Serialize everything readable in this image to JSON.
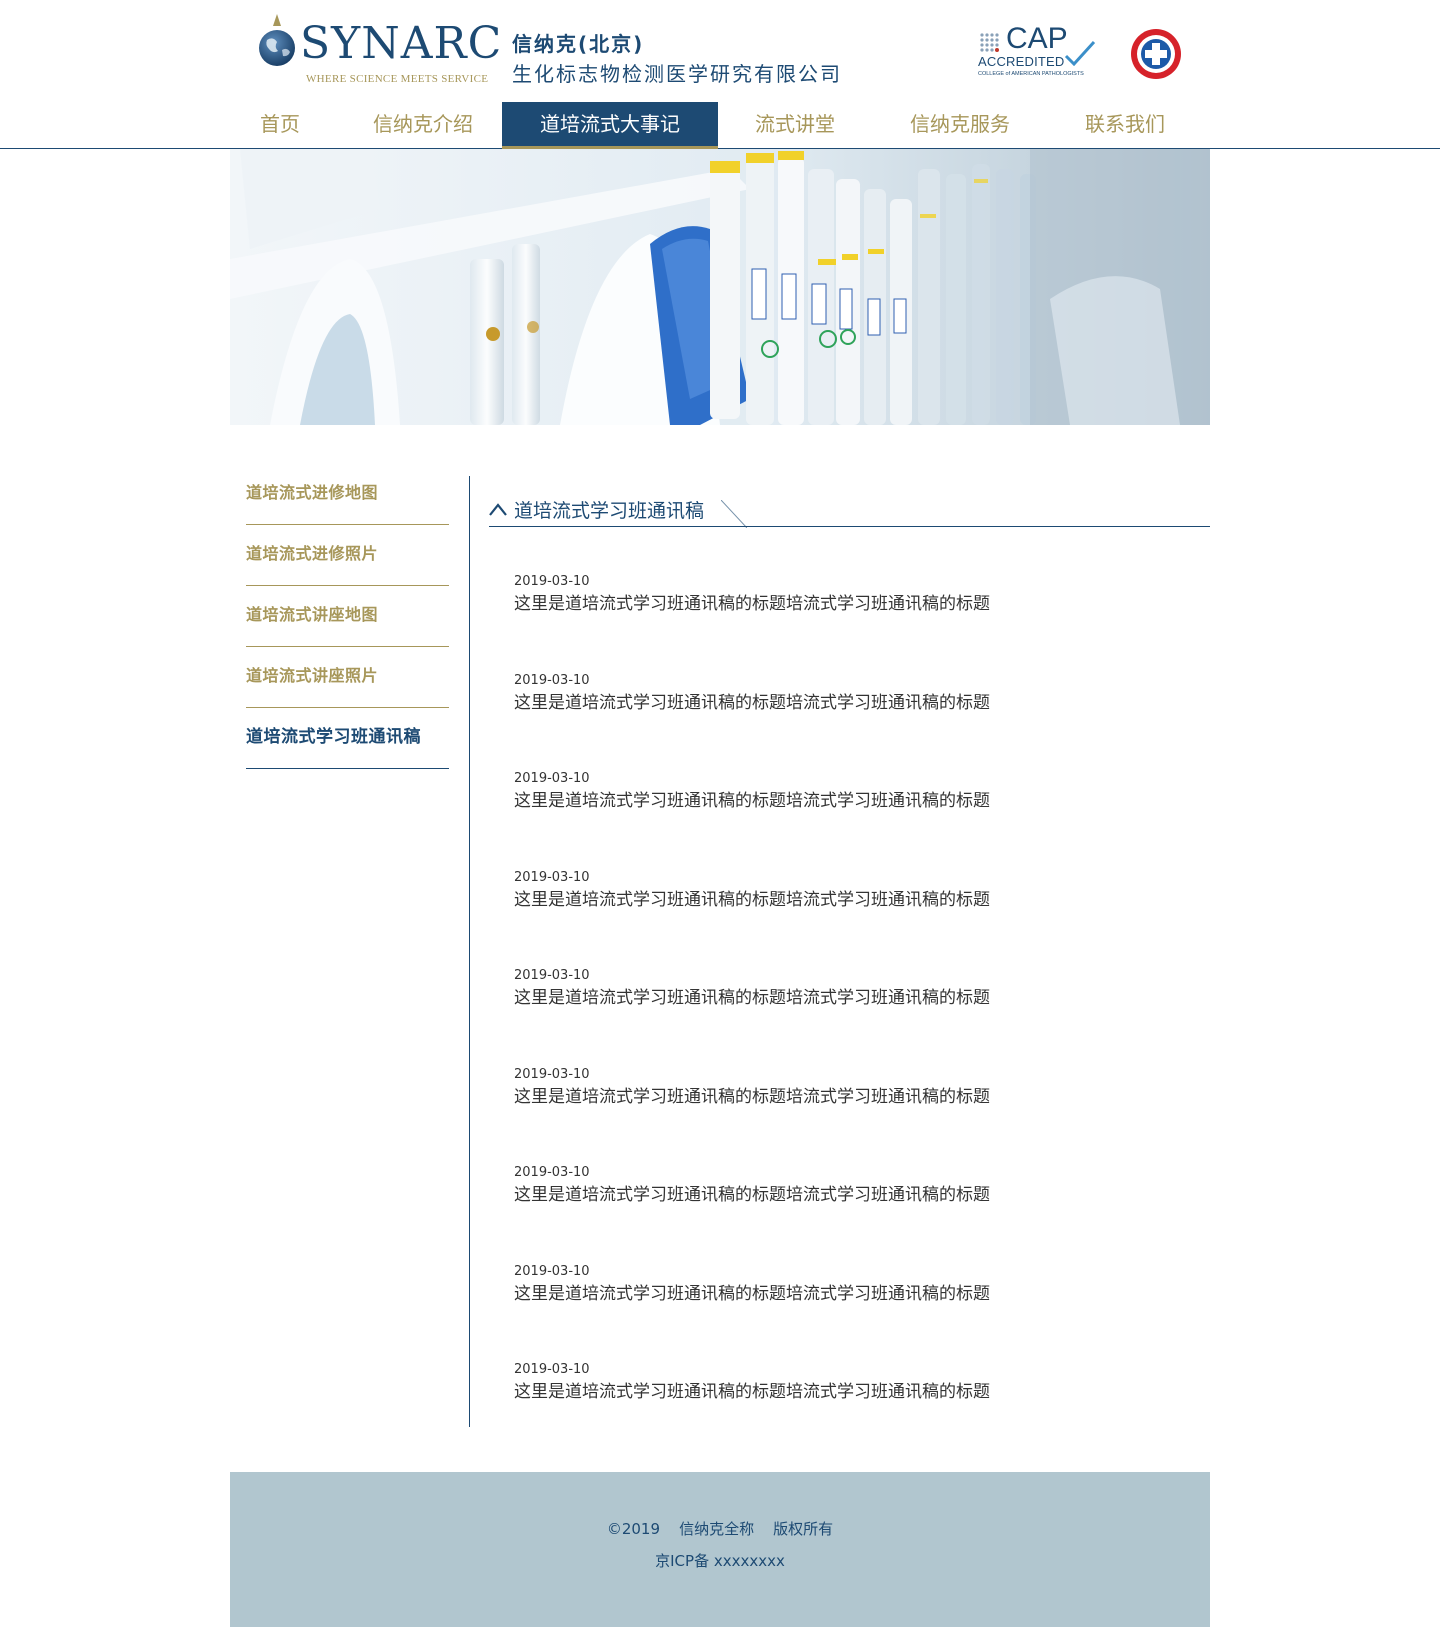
{
  "header": {
    "logo_word": "SYNARC",
    "logo_tagline": "WHERE SCIENCE MEETS SERVICE",
    "company_name": "信纳克(北京)",
    "company_subtitle": "生化标志物检测医学研究有限公司",
    "cap_word": "CAP",
    "cap_accredited": "ACCREDITED",
    "cap_college": "COLLEGE of AMERICAN PATHOLOGISTS",
    "seal_icon": "red-cross-seal-icon"
  },
  "nav": {
    "items": [
      {
        "label": "首页"
      },
      {
        "label": "信纳克介绍"
      },
      {
        "label": "道培流式大事记",
        "active": true
      },
      {
        "label": "流式讲堂"
      },
      {
        "label": "信纳克服务"
      },
      {
        "label": "联系我们"
      }
    ]
  },
  "banner": {
    "image": "laboratory pipettes photo"
  },
  "sidebar": {
    "items": [
      {
        "label": "道培流式进修地图"
      },
      {
        "label": "道培流式进修照片"
      },
      {
        "label": "道培流式讲座地图"
      },
      {
        "label": "道培流式讲座照片"
      },
      {
        "label": "道培流式学习班通讯稿",
        "active": true
      }
    ]
  },
  "section": {
    "title": "道培流式学习班通讯稿"
  },
  "articles": [
    {
      "date": "2019-03-10",
      "title": "这里是道培流式学习班通讯稿的标题培流式学习班通讯稿的标题"
    },
    {
      "date": "2019-03-10",
      "title": "这里是道培流式学习班通讯稿的标题培流式学习班通讯稿的标题"
    },
    {
      "date": "2019-03-10",
      "title": "这里是道培流式学习班通讯稿的标题培流式学习班通讯稿的标题"
    },
    {
      "date": "2019-03-10",
      "title": "这里是道培流式学习班通讯稿的标题培流式学习班通讯稿的标题"
    },
    {
      "date": "2019-03-10",
      "title": "这里是道培流式学习班通讯稿的标题培流式学习班通讯稿的标题"
    },
    {
      "date": "2019-03-10",
      "title": "这里是道培流式学习班通讯稿的标题培流式学习班通讯稿的标题"
    },
    {
      "date": "2019-03-10",
      "title": "这里是道培流式学习班通讯稿的标题培流式学习班通讯稿的标题"
    },
    {
      "date": "2019-03-10",
      "title": "这里是道培流式学习班通讯稿的标题培流式学习班通讯稿的标题"
    },
    {
      "date": "2019-03-10",
      "title": "这里是道培流式学习班通讯稿的标题培流式学习班通讯稿的标题"
    }
  ],
  "footer": {
    "copyright": "©2019    信纳克全称    版权所有",
    "icp": "京ICP备 xxxxxxxx"
  },
  "colors": {
    "primary": "#1d4a73",
    "gold": "#a7975a",
    "footer_bg": "#b1c6cf"
  }
}
